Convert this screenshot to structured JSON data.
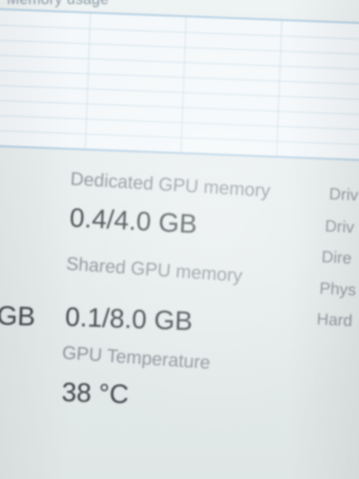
{
  "graph": {
    "title_fragment": "Memory usage"
  },
  "dedicated_gpu_memory": {
    "label": "Dedicated GPU memory",
    "value": "0.4/4.0 GB"
  },
  "shared_gpu_memory": {
    "label": "Shared GPU memory",
    "value": "0.1/8.0 GB"
  },
  "gpu_temperature": {
    "label": "GPU Temperature",
    "value": "38 °C"
  },
  "left_column_fragment": {
    "value": "GB"
  },
  "right_column_fragments": [
    "Driv",
    "Driv",
    "Dire",
    "Phys",
    "Hard"
  ],
  "colors": {
    "graph_border": "#9fc3de",
    "graph_grid": "#c7dbe8",
    "label_text": "#8b9198",
    "value_text": "#3f4448"
  }
}
